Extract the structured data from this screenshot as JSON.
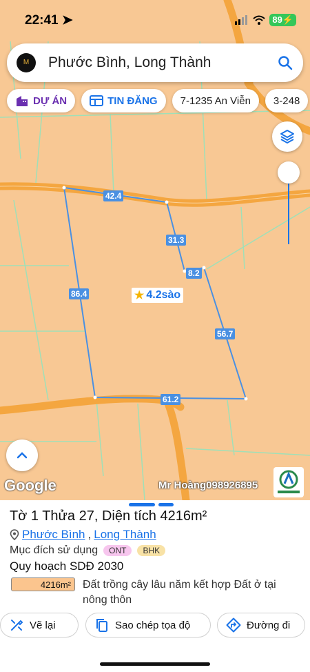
{
  "status": {
    "time": "22:41",
    "battery": "89"
  },
  "search": {
    "query": "Phước Bình, Long Thành",
    "logo_text": "M"
  },
  "chips": [
    {
      "label": "DỰ ÁN",
      "icon": "building-icon"
    },
    {
      "label": "TIN ĐĂNG",
      "icon": "listing-icon"
    },
    {
      "label": "7-1235 An Viễn"
    },
    {
      "label": "3-248"
    }
  ],
  "map": {
    "edges": [
      "42.4",
      "31.3",
      "8.2",
      "86.4",
      "56.7",
      "61.2"
    ],
    "area_label": "4.2sào",
    "google": "Google",
    "watermark": "Mr Hoàng098926895",
    "colors": {
      "land": "#f8c894",
      "road": "#f4a640",
      "parcel_line": "#4a90e2"
    }
  },
  "sheet": {
    "title": "Tờ 1 Thửa 27, Diện tích 4216m²",
    "ward": "Phước Bình",
    "district": "Long Thành",
    "separator": ",",
    "purpose_label": "Mục đích sử dụng",
    "purpose_tags": [
      "ONT",
      "BHK"
    ],
    "plan_label": "Quy hoạch SDĐ 2030",
    "plan_area": "4216m²",
    "plan_desc": "Đất trồng cây lâu năm kết hợp Đất ở tại nông thôn",
    "buttons": {
      "redraw": "Vẽ lại",
      "copy_coords": "Sao chép tọa độ",
      "directions": "Đường đi"
    }
  }
}
